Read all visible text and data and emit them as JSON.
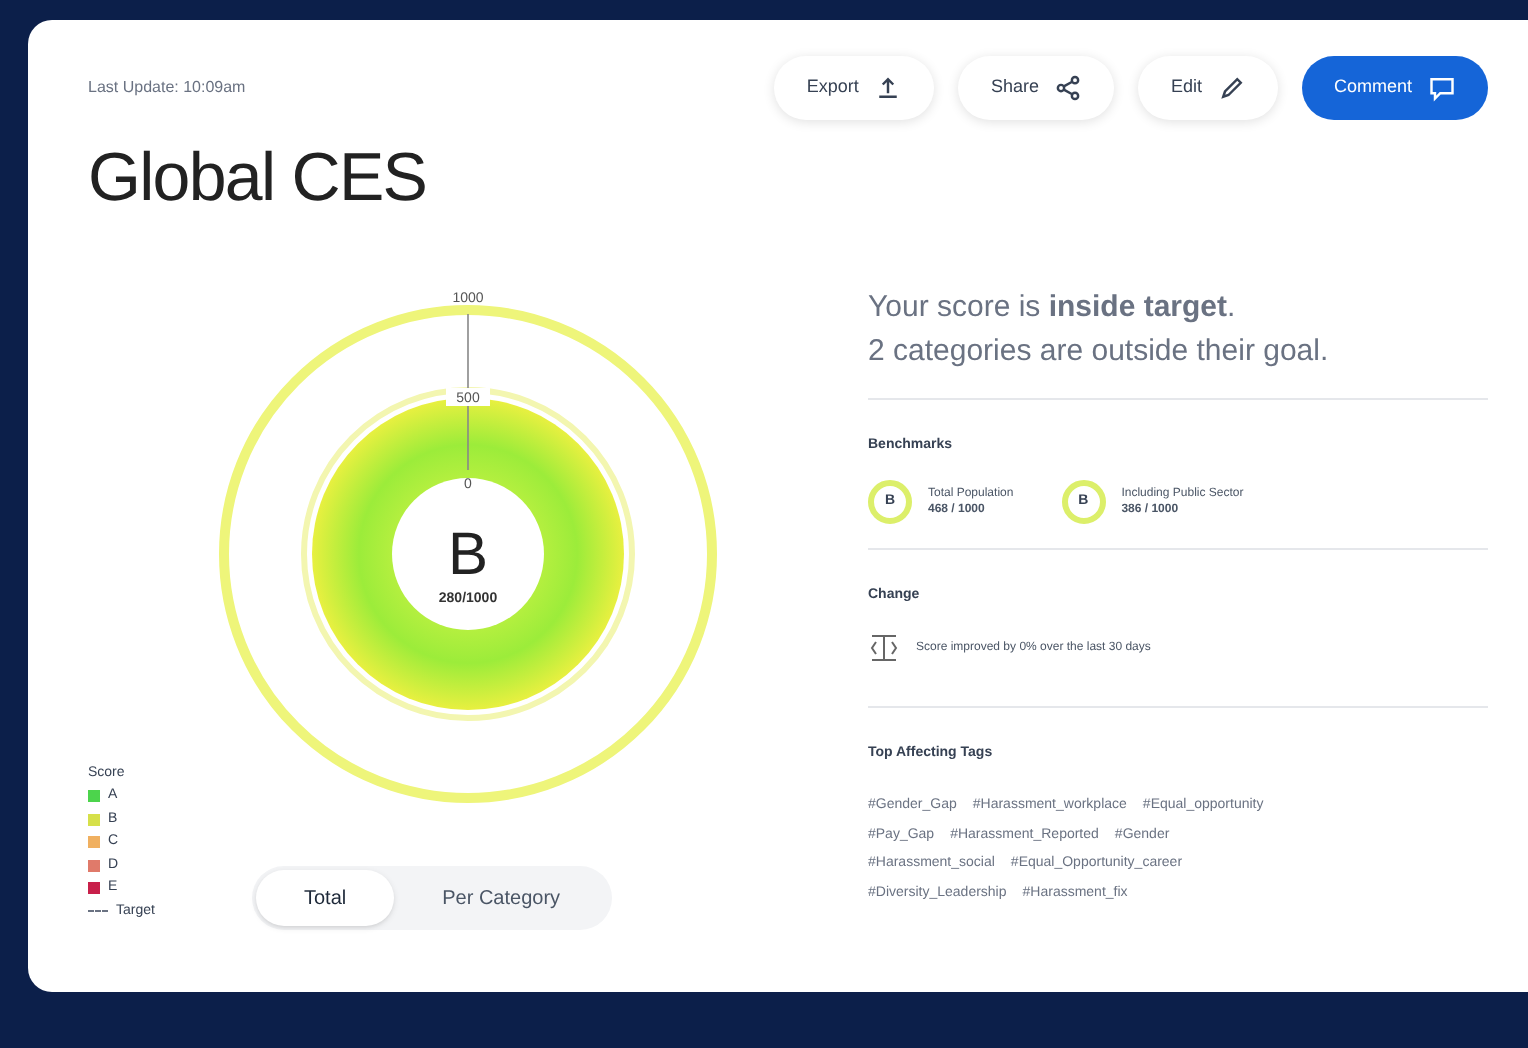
{
  "last_update": "Last Update: 10:09am",
  "actions": [
    {
      "label": "Export",
      "kind": "export",
      "primary": false
    },
    {
      "label": "Share",
      "kind": "share",
      "primary": false
    },
    {
      "label": "Edit",
      "kind": "edit",
      "primary": false
    },
    {
      "label": "Comment",
      "kind": "comment",
      "primary": true
    }
  ],
  "title": "Global CES",
  "ring": {
    "outer_label": "1000",
    "target_label": "500",
    "inner_label": "0",
    "grade": "B",
    "score": "280/1000"
  },
  "legend": {
    "title": "Score",
    "items": [
      {
        "label": "A",
        "color": "#4cd44c"
      },
      {
        "label": "B",
        "color": "#d6e04a"
      },
      {
        "label": "C",
        "color": "#f0b060"
      },
      {
        "label": "D",
        "color": "#e07a6a"
      },
      {
        "label": "E",
        "color": "#c8204a"
      }
    ],
    "target": "Target"
  },
  "toggle": [
    {
      "label": "Total",
      "selected": true
    },
    {
      "label": "Per Category",
      "selected": false
    }
  ],
  "summary": {
    "line1": "Your score is **inside target**.",
    "line2": "2 categories are outside their goal."
  },
  "benchmarks": {
    "title": "Benchmarks",
    "items": [
      {
        "grade": "B",
        "name": "Total Population",
        "score": "468 / 1000"
      },
      {
        "grade": "B",
        "name": "Including Public Sector",
        "score": "386 / 1000"
      }
    ]
  },
  "change": {
    "title": "Change",
    "text": "Score improved by 0% over the last 30 days"
  },
  "tags": {
    "title": "Top Affecting Tags",
    "lines": [
      [
        "#Gender_Gap",
        "#Harassment_workplace",
        "#Equal_opportunity"
      ],
      [
        "#Pay_Gap",
        "#Harassment_Reported",
        "#Gender"
      ],
      [
        "#Harassment_social",
        "#Equal_Opportunity_career"
      ],
      [
        "#Diversity_Leadership",
        "#Harassment_fix"
      ]
    ]
  }
}
